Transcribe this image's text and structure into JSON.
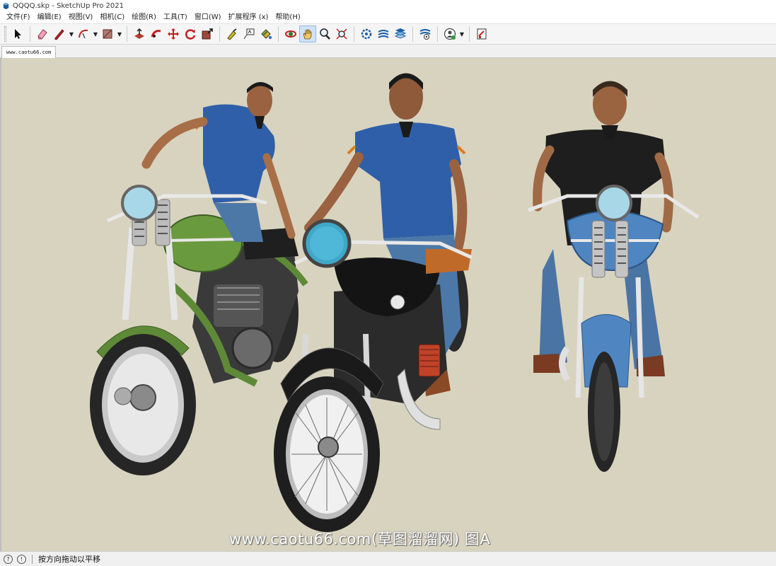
{
  "window": {
    "title": "QQQQ.skp - SketchUp Pro 2021"
  },
  "menubar": [
    {
      "label": "文件(F)"
    },
    {
      "label": "编辑(E)"
    },
    {
      "label": "视图(V)"
    },
    {
      "label": "相机(C)"
    },
    {
      "label": "绘图(R)"
    },
    {
      "label": "工具(T)"
    },
    {
      "label": "窗口(W)"
    },
    {
      "label": "扩展程序 (x)"
    },
    {
      "label": "帮助(H)"
    }
  ],
  "toolbar": {
    "tools": [
      {
        "icon": "select-arrow-icon"
      },
      {
        "icon": "eraser-icon"
      },
      {
        "icon": "pencil-line-icon"
      },
      {
        "icon": "arc-icon"
      },
      {
        "icon": "rectangle-icon"
      },
      {
        "icon": "push-pull-icon"
      },
      {
        "icon": "follow-me-icon"
      },
      {
        "icon": "move-icon"
      },
      {
        "icon": "rotate-icon"
      },
      {
        "icon": "scale-icon"
      },
      {
        "icon": "tape-measure-icon"
      },
      {
        "icon": "text-label-icon"
      },
      {
        "icon": "paint-bucket-icon"
      },
      {
        "icon": "orbit-icon"
      },
      {
        "icon": "pan-hand-icon"
      },
      {
        "icon": "zoom-icon"
      },
      {
        "icon": "zoom-extents-icon"
      },
      {
        "icon": "3d-warehouse-icon"
      },
      {
        "icon": "extension-warehouse-icon"
      },
      {
        "icon": "layout-icon"
      },
      {
        "icon": "extension-manager-icon"
      },
      {
        "icon": "account-icon"
      },
      {
        "icon": "send-to-layout-icon"
      }
    ],
    "active_tool": "pan-hand-icon"
  },
  "scene_tab": {
    "label": "www.caotu66.com"
  },
  "viewport": {
    "background": "#d8d3bf",
    "watermark": "www.caotu66.com(草图溜溜网) 图A",
    "model": {
      "riders": [
        {
          "shirt_color": "#2f5fa8",
          "bike": "green-motorcycle",
          "bike_color": "#5e8a38"
        },
        {
          "shirt_color": "#2f5fa8",
          "bike": "black-motorcycle",
          "bike_color": "#1b1b1b"
        },
        {
          "shirt_color": "#1e1e1e",
          "bike": "blue-motorcycle",
          "bike_color": "#4f86c2"
        }
      ]
    }
  },
  "statusbar": {
    "icons": [
      {
        "icon": "geolocation-icon"
      },
      {
        "icon": "info-icon"
      }
    ],
    "message": "按方向拖动以平移"
  }
}
